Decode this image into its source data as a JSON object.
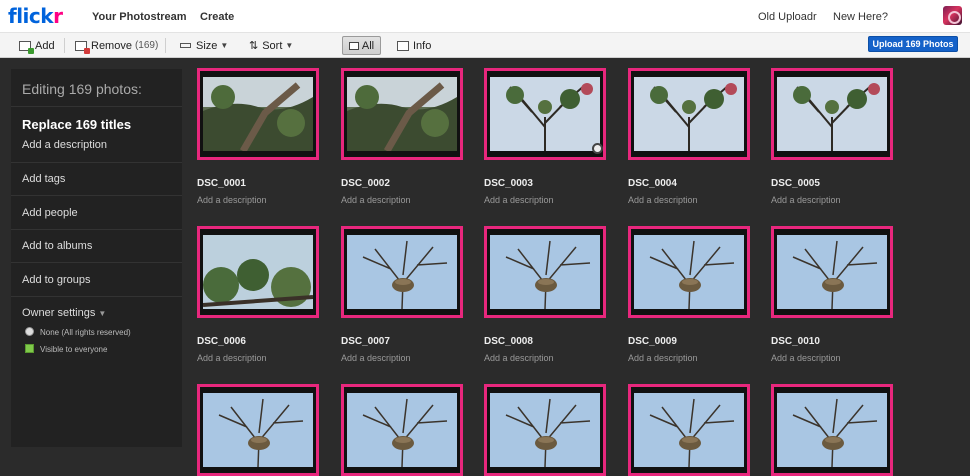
{
  "header": {
    "logo_left": "flick",
    "logo_right": "r",
    "nav": [
      "Your Photostream",
      "Create"
    ],
    "right": [
      "Old Uploadr",
      "New Here?"
    ]
  },
  "toolbar": {
    "add": "Add",
    "remove": "Remove",
    "remove_count": "(169)",
    "size": "Size",
    "sort": "Sort",
    "all": "All",
    "info": "Info",
    "upload": "Upload 169 Photos"
  },
  "sidebar": {
    "heading": "Editing 169 photos:",
    "replace_titles": "Replace 169 titles",
    "add_description": "Add a description",
    "add_tags": "Add tags",
    "add_people": "Add people",
    "add_albums": "Add to albums",
    "add_groups": "Add to groups",
    "owner_settings": "Owner settings",
    "license": "None (All rights reserved)",
    "visibility": "Visible to everyone"
  },
  "photos": [
    {
      "title": "DSC_0001",
      "desc": "Add a description",
      "scene": "branch"
    },
    {
      "title": "DSC_0002",
      "desc": "Add a description",
      "scene": "branch"
    },
    {
      "title": "DSC_0003",
      "desc": "Add a description",
      "scene": "tree"
    },
    {
      "title": "DSC_0004",
      "desc": "Add a description",
      "scene": "tree"
    },
    {
      "title": "DSC_0005",
      "desc": "Add a description",
      "scene": "tree"
    },
    {
      "title": "DSC_0006",
      "desc": "Add a description",
      "scene": "leaves"
    },
    {
      "title": "DSC_0007",
      "desc": "Add a description",
      "scene": "nest"
    },
    {
      "title": "DSC_0008",
      "desc": "Add a description",
      "scene": "nest"
    },
    {
      "title": "DSC_0009",
      "desc": "Add a description",
      "scene": "nest"
    },
    {
      "title": "DSC_0010",
      "desc": "Add a description",
      "scene": "nest"
    },
    {
      "title": "",
      "desc": "",
      "scene": "nest"
    },
    {
      "title": "",
      "desc": "",
      "scene": "nest"
    },
    {
      "title": "",
      "desc": "",
      "scene": "nest"
    },
    {
      "title": "",
      "desc": "",
      "scene": "nest"
    },
    {
      "title": "",
      "desc": "",
      "scene": "nest"
    }
  ],
  "colors": {
    "frame": "#e8277d",
    "primary": "#1562c9",
    "logo_blue": "#0063dc",
    "logo_pink": "#ff0084"
  }
}
